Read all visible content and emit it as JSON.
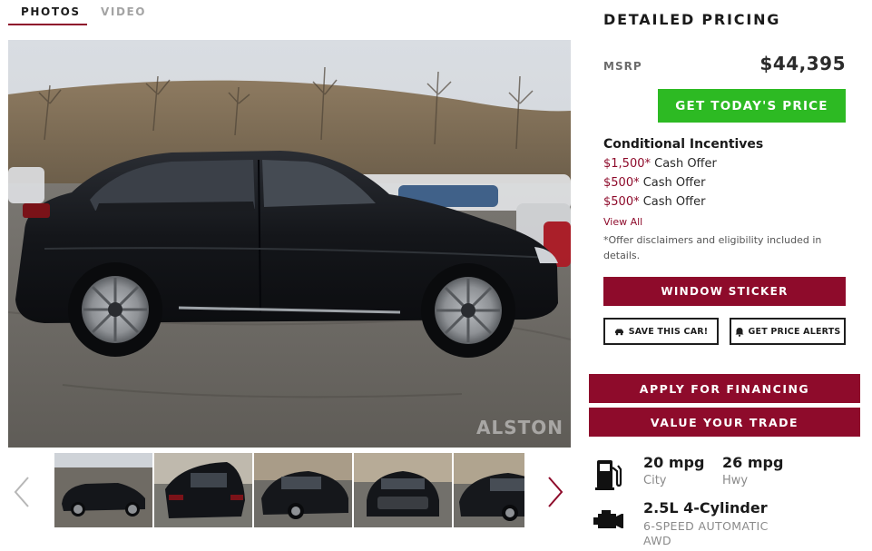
{
  "media_tabs": [
    {
      "label": "PHOTOS",
      "active": true
    },
    {
      "label": "VIDEO",
      "active": false
    }
  ],
  "main_photo": {
    "subject": "black-suv-side-view",
    "watermark": "ALSTON"
  },
  "thumbnails": {
    "count_visible": 5,
    "prev_icon": "chevron-left-icon",
    "next_icon": "chevron-right-icon"
  },
  "pricing": {
    "title": "DETAILED PRICING",
    "msrp_label": "MSRP",
    "msrp_value": "$44,395",
    "cta_label": "GET TODAY'S PRICE",
    "incentives_title": "Conditional Incentives",
    "offers": [
      {
        "amount": "$1,500*",
        "label": "Cash Offer"
      },
      {
        "amount": "$500*",
        "label": "Cash Offer"
      },
      {
        "amount": "$500*",
        "label": "Cash Offer"
      }
    ],
    "view_all": "View All",
    "disclaimer": "*Offer disclaimers and eligibility included in details.",
    "window_sticker": "WINDOW STICKER",
    "save_car": "SAVE THIS CAR!",
    "price_alerts": "GET PRICE ALERTS"
  },
  "actions": {
    "financing": "APPLY FOR FINANCING",
    "trade": "VALUE YOUR TRADE"
  },
  "specs": {
    "city_mpg": "20 mpg",
    "city_label": "City",
    "hwy_mpg": "26 mpg",
    "hwy_label": "Hwy",
    "engine": "2.5L 4-Cylinder",
    "transmission": "6-SPEED AUTOMATIC",
    "drivetrain": "AWD"
  },
  "colors": {
    "accent": "#8e0b2b",
    "cta_green": "#2dba23",
    "car_body": "#15171b"
  }
}
